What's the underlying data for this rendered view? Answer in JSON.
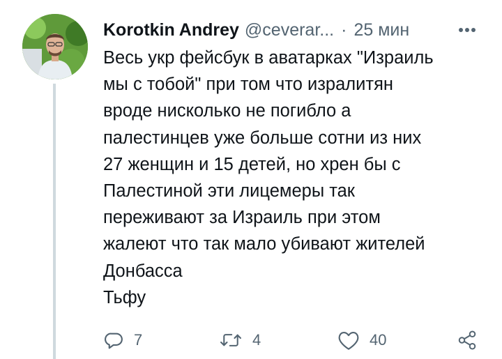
{
  "tweet": {
    "author_name": "Korotkin Andrey",
    "handle": "@ceverar...",
    "separator": "·",
    "time": "25 мин",
    "body_lines": [
      "Весь укр фейсбук в аватарках \"Израиль",
      "мы с тобой\" при том что изралитян",
      "вроде нисколько не погибло а",
      "палестинцев уже больше сотни из них",
      "27 женщин и 15 детей, но хрен бы с",
      "Палестиной эти лицемеры так",
      "переживают за Израиль при этом",
      "жалеют что так мало убивают жителей",
      "Донбасса",
      "Тьфу"
    ],
    "reply_count": "7",
    "retweet_count": "4",
    "like_count": "40"
  },
  "icons": {
    "more": "more-dots-icon",
    "reply": "reply-icon",
    "retweet": "retweet-icon",
    "like": "heart-icon",
    "share": "share-icon"
  },
  "colors": {
    "text": "#0f1419",
    "secondary": "#536471",
    "thread_line": "#cfd9de"
  }
}
